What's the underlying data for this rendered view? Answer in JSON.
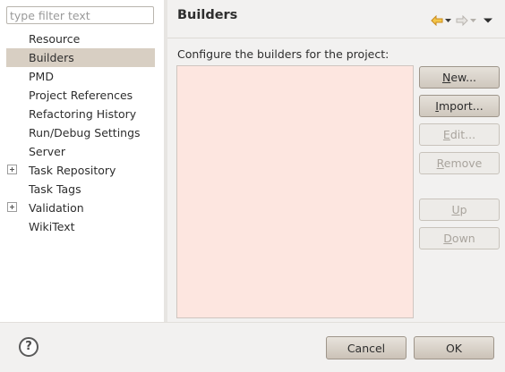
{
  "filter": {
    "placeholder": "type filter text",
    "value": ""
  },
  "tree": {
    "items": [
      {
        "label": "Resource",
        "expandable": false,
        "selected": false
      },
      {
        "label": "Builders",
        "expandable": false,
        "selected": true
      },
      {
        "label": "PMD",
        "expandable": false,
        "selected": false
      },
      {
        "label": "Project References",
        "expandable": false,
        "selected": false
      },
      {
        "label": "Refactoring History",
        "expandable": false,
        "selected": false
      },
      {
        "label": "Run/Debug Settings",
        "expandable": false,
        "selected": false
      },
      {
        "label": "Server",
        "expandable": false,
        "selected": false
      },
      {
        "label": "Task Repository",
        "expandable": true,
        "selected": false
      },
      {
        "label": "Task Tags",
        "expandable": false,
        "selected": false
      },
      {
        "label": "Validation",
        "expandable": true,
        "selected": false
      },
      {
        "label": "WikiText",
        "expandable": false,
        "selected": false
      }
    ]
  },
  "page": {
    "title": "Builders",
    "description": "Configure the builders for the project:"
  },
  "buttons": {
    "new": {
      "mnemonic": "N",
      "rest": "ew...",
      "enabled": true
    },
    "import": {
      "mnemonic": "I",
      "rest": "mport...",
      "enabled": true
    },
    "edit": {
      "mnemonic": "E",
      "rest": "dit...",
      "enabled": false
    },
    "remove": {
      "mnemonic": "R",
      "rest": "emove",
      "enabled": false
    },
    "up": {
      "mnemonic": "U",
      "rest": "p",
      "enabled": false
    },
    "down": {
      "mnemonic": "D",
      "rest": "own",
      "enabled": false
    }
  },
  "dialog": {
    "help_glyph": "?",
    "cancel_label": "Cancel",
    "ok_label": "OK"
  },
  "colors": {
    "list_background": "#fde6e0",
    "selection": "#d8cfc3",
    "back_arrow": "#e0a020"
  },
  "icons": {
    "back": "back-arrow-icon",
    "back_menu": "back-dropdown-icon",
    "forward": "forward-arrow-icon",
    "forward_menu": "forward-dropdown-icon",
    "view_menu": "view-menu-icon",
    "help": "help-icon",
    "expand": "plus-expander-icon"
  }
}
